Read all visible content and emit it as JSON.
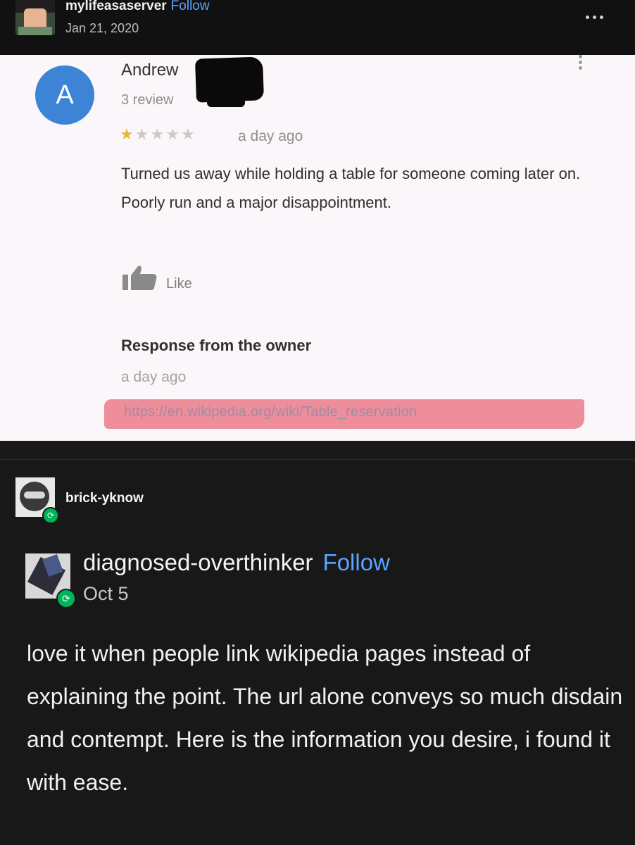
{
  "top_post": {
    "username": "mylifeasaserver",
    "follow_label": "Follow",
    "date": "Jan 21, 2020",
    "more_icon": "more-icon"
  },
  "review": {
    "avatar_letter": "A",
    "reviewer_name": "Andrew",
    "review_count": "3 review",
    "rating": 1,
    "rating_max": 5,
    "time": "a day ago",
    "text": "Turned us away while holding a table for someone coming later on. Poorly run and a major disappointment.",
    "like_label": "Like",
    "response_title": "Response from the owner",
    "response_time": "a day ago",
    "response_link": "https://en.wikipedia.org/wiki/Table_reservation",
    "colors": {
      "avatar": "#3d84d6",
      "star": "#e9b53b",
      "highlight": "#ec7f8c"
    }
  },
  "reblog": {
    "username": "brick-yknow"
  },
  "original_post": {
    "username": "diagnosed-overthinker",
    "follow_label": "Follow",
    "date": "Oct 5",
    "body": "love it when people link wikipedia pages instead of explaining the point. The url alone conveys so much disdain and contempt. Here is the information you desire, i found it with ease."
  },
  "colors": {
    "background": "#181818",
    "follow": "#5aa4ff",
    "reblog_badge": "#00b45a"
  }
}
